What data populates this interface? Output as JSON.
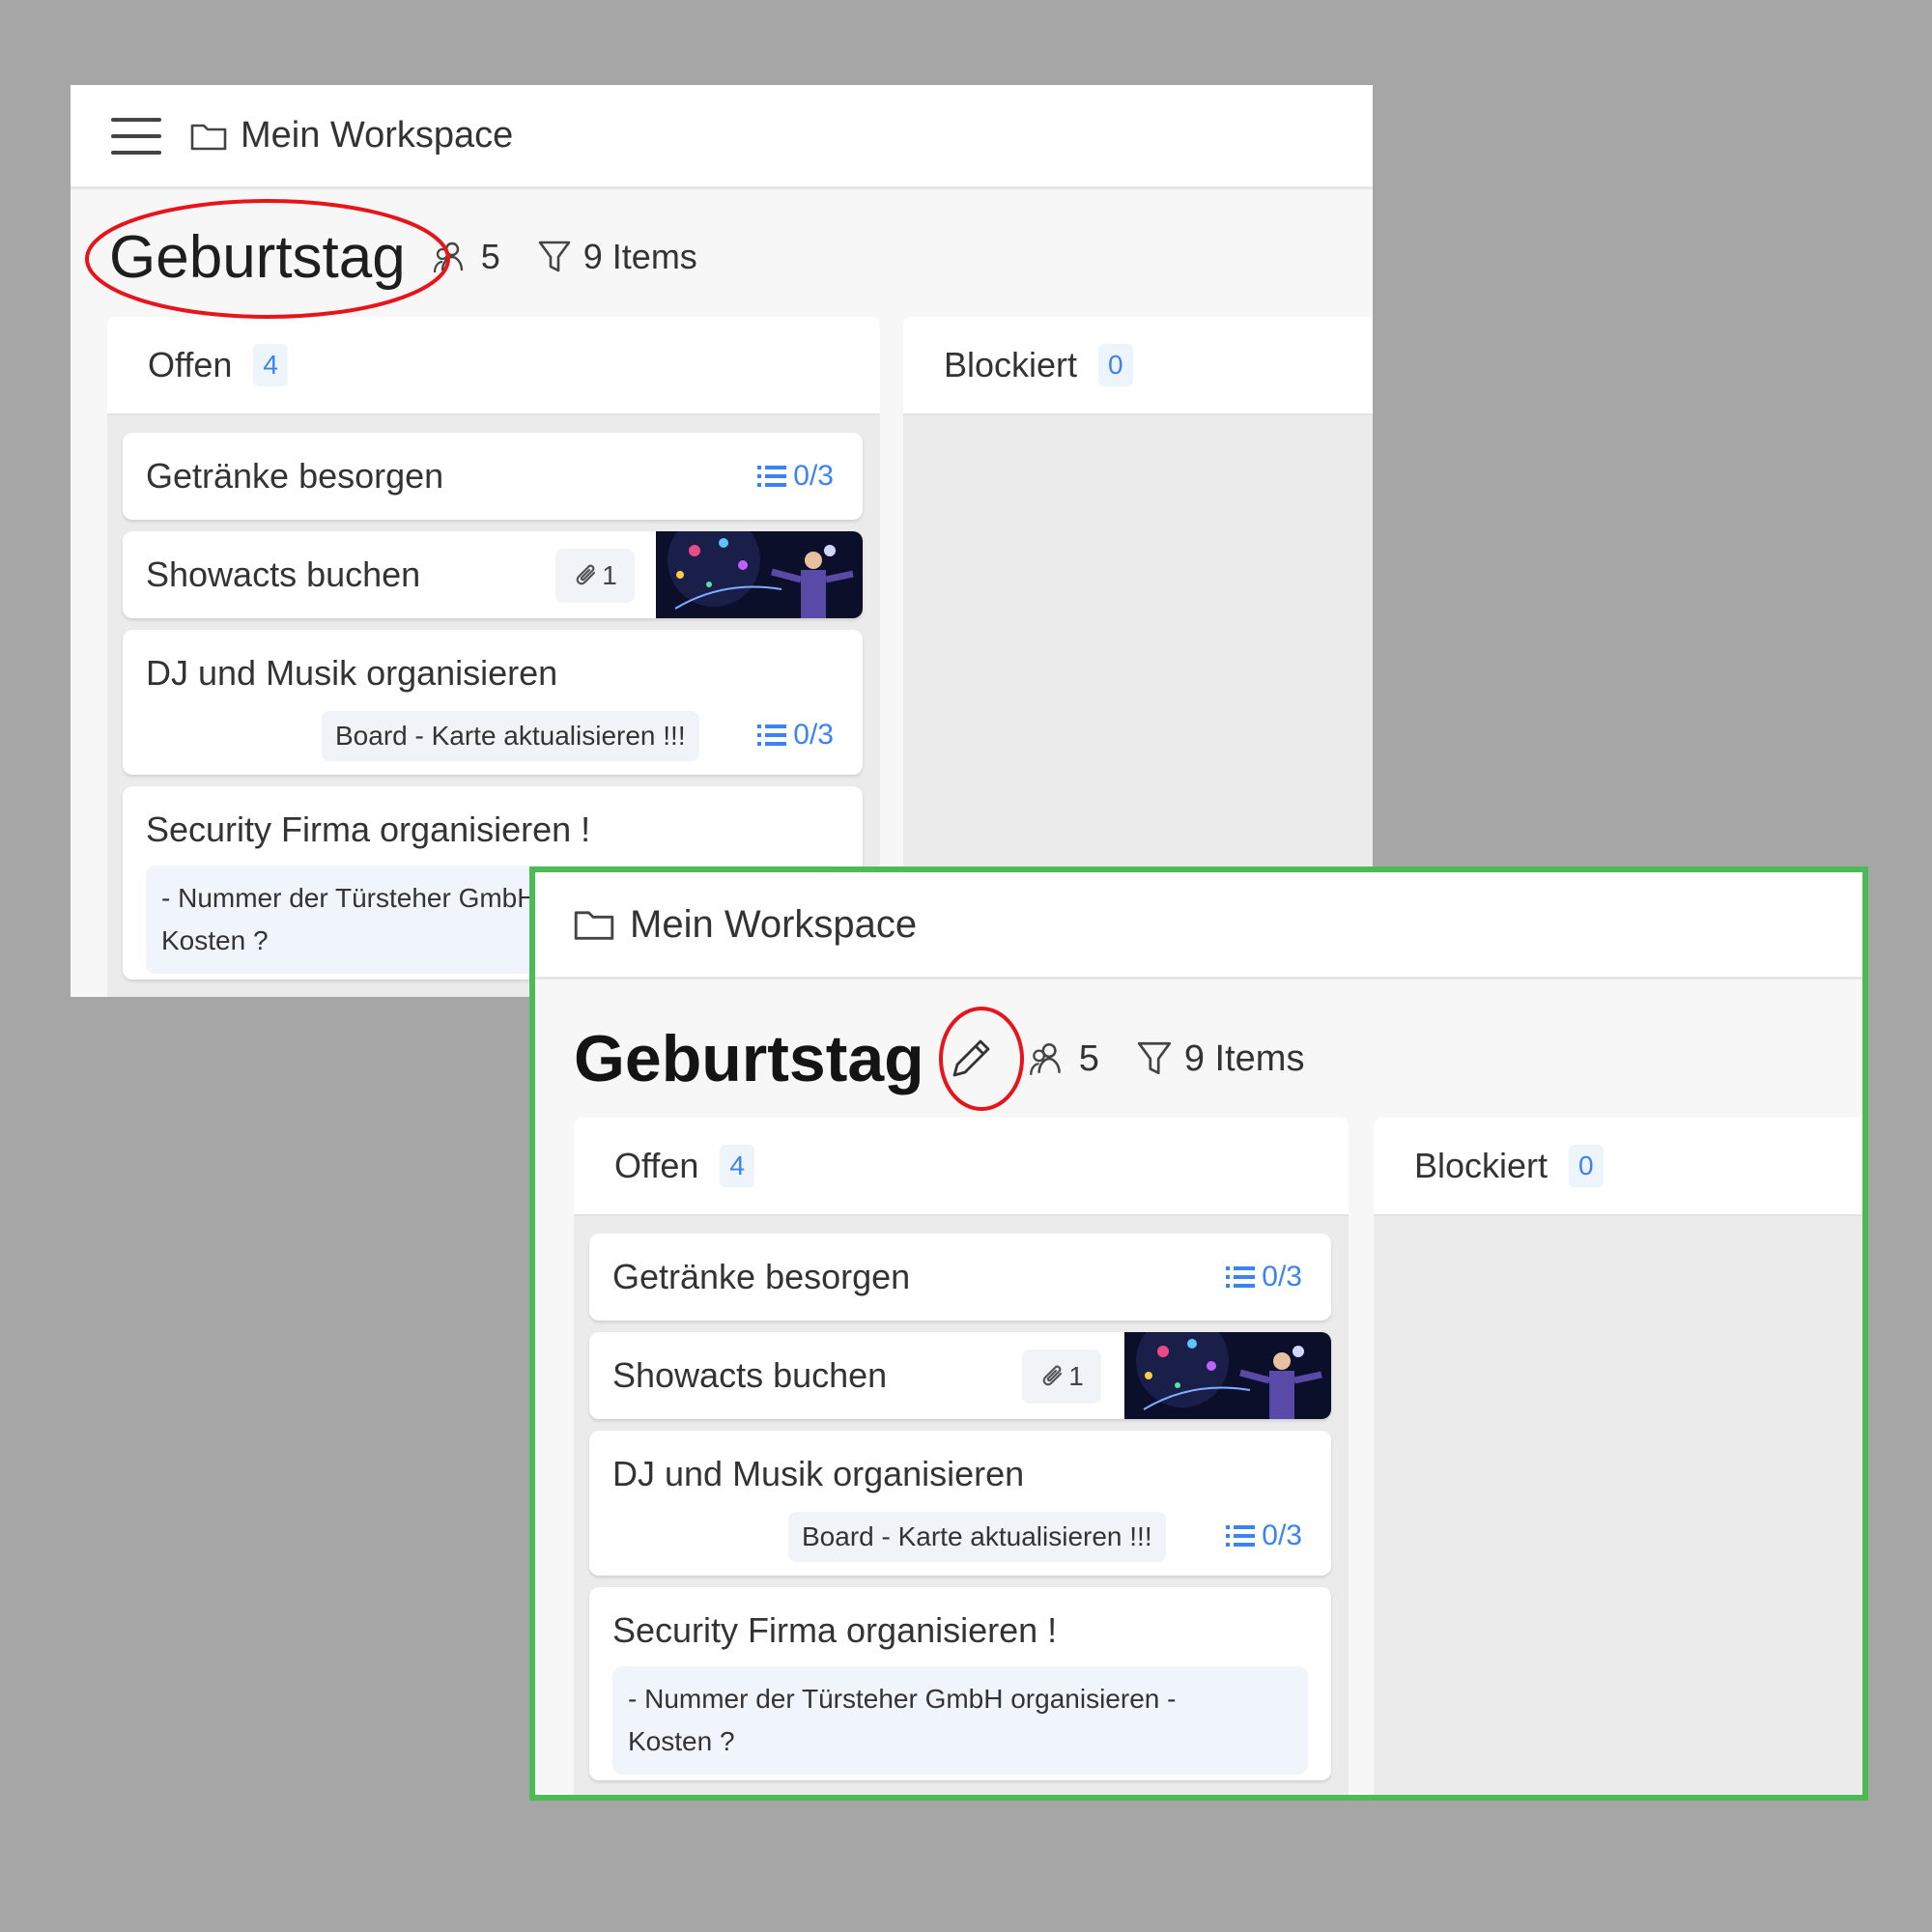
{
  "workspace": {
    "name": "Mein Workspace"
  },
  "board": {
    "title": "Geburtstag",
    "members_count": "5",
    "items_label": "9 Items"
  },
  "columns": [
    {
      "title": "Offen",
      "count": "4"
    },
    {
      "title": "Blockiert",
      "count": "0"
    }
  ],
  "cards": [
    {
      "title": "Getränke besorgen",
      "checklist": "0/3"
    },
    {
      "title": "Showacts buchen",
      "attachments": "1"
    },
    {
      "title": "DJ und Musik organisieren",
      "tag": "Board - Karte aktualisieren !!!",
      "checklist": "0/3"
    },
    {
      "title": "Security Firma organisieren !",
      "description_line1": "- Nummer der Türsteher GmbH organisieren -",
      "description_line2": "Kosten ?"
    }
  ],
  "colors": {
    "accent_blue": "#3b82f6",
    "highlight_red": "#e8141c",
    "frame_green": "#4cbb55",
    "backdrop": "#a6a6a6"
  },
  "icons": [
    "menu-icon",
    "folder-icon",
    "edit-pencil-icon",
    "members-icon",
    "filter-icon",
    "checklist-icon",
    "paperclip-icon"
  ]
}
